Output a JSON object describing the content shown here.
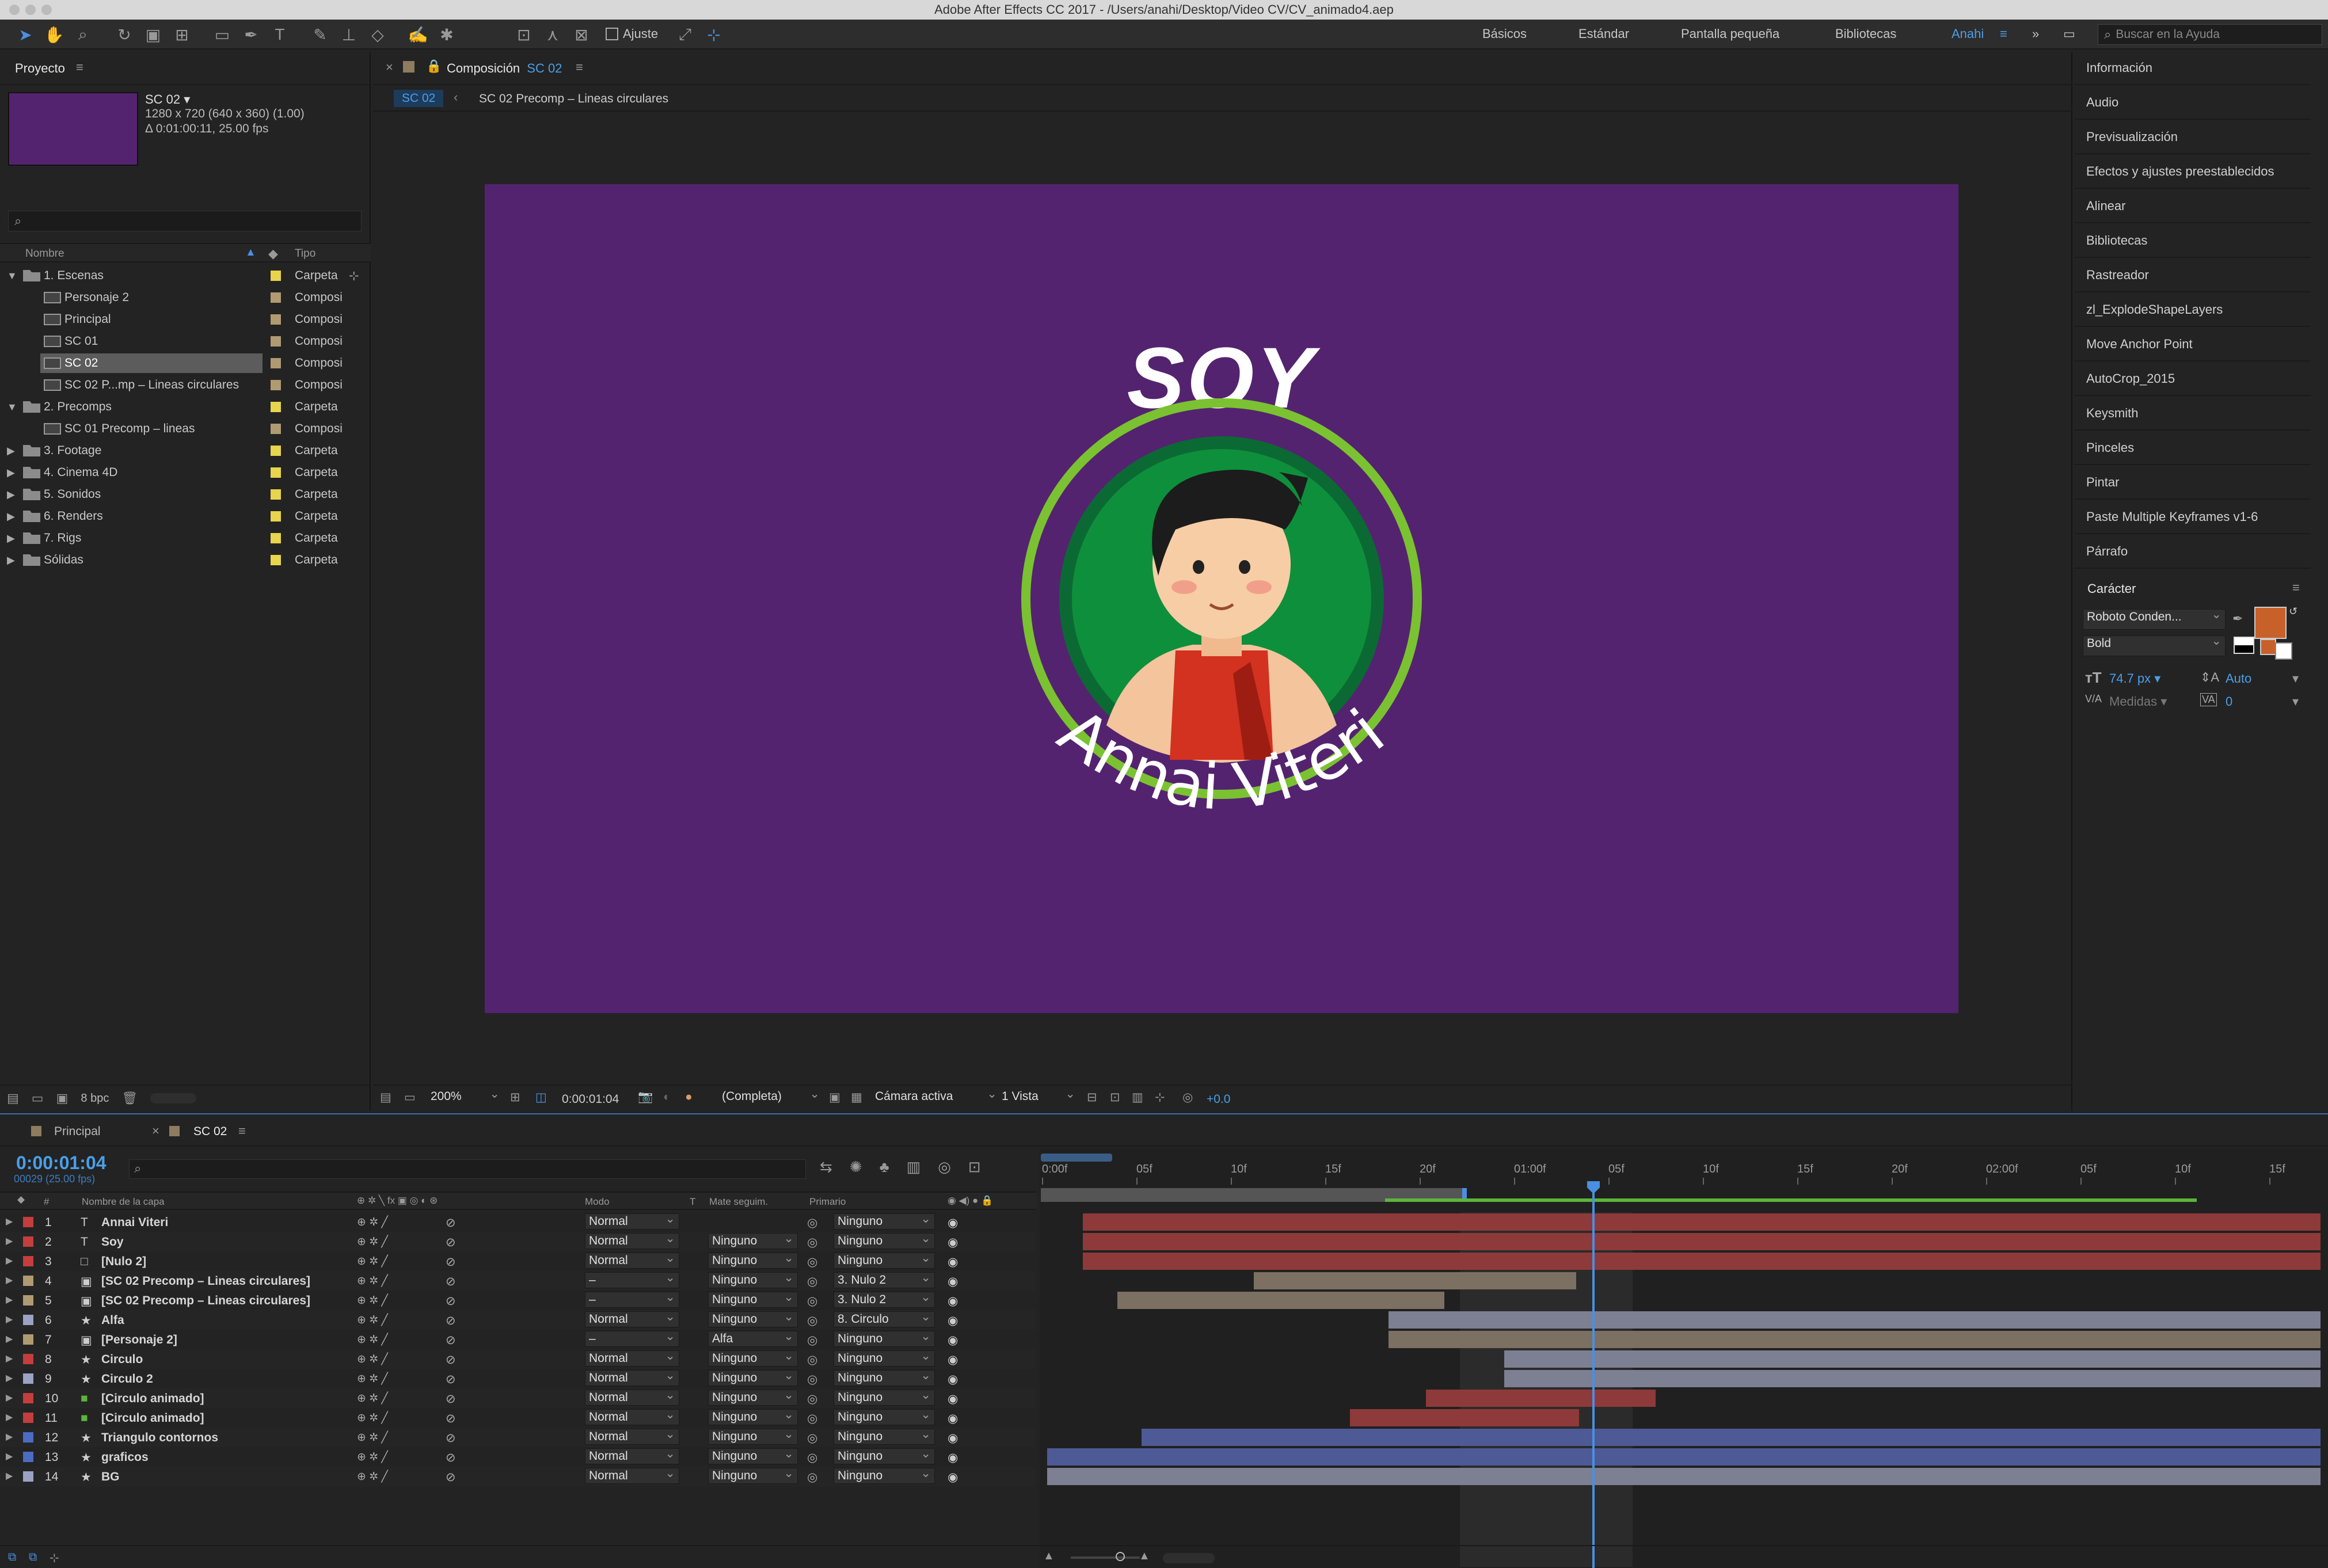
{
  "app": {
    "title": "Adobe After Effects CC 2017 - /Users/anahi/Desktop/Video CV/CV_animado4.aep"
  },
  "toolbar": {
    "snap_label": "Ajuste",
    "workspaces": [
      "Básicos",
      "Estándar",
      "Pantalla pequeña",
      "Bibliotecas",
      "Anahi"
    ],
    "active_workspace": "Anahi",
    "search_placeholder": "Buscar en la Ayuda"
  },
  "project": {
    "title": "Proyecto",
    "selected_name": "SC 02 ▾",
    "selected_info1": "1280 x 720  (640 x 360) (1.00)",
    "selected_info2": "Δ 0:01:00:11, 25.00 fps",
    "col_name": "Nombre",
    "col_type": "Tipo",
    "items": [
      {
        "name": "1. Escenas",
        "type": "Carpeta",
        "kind": "folder",
        "indent": 0,
        "open": true
      },
      {
        "name": "Personaje 2",
        "type": "Composi",
        "kind": "comp",
        "indent": 1
      },
      {
        "name": "Principal",
        "type": "Composi",
        "kind": "comp",
        "indent": 1
      },
      {
        "name": "SC 01",
        "type": "Composi",
        "kind": "comp",
        "indent": 1
      },
      {
        "name": "SC 02",
        "type": "Composi",
        "kind": "comp",
        "indent": 1,
        "selected": true
      },
      {
        "name": "SC 02 P...mp – Lineas circulares",
        "type": "Composi",
        "kind": "comp",
        "indent": 1
      },
      {
        "name": "2. Precomps",
        "type": "Carpeta",
        "kind": "folder",
        "indent": 0,
        "open": true
      },
      {
        "name": "SC 01 Precomp – lineas",
        "type": "Composi",
        "kind": "comp",
        "indent": 1
      },
      {
        "name": "3. Footage",
        "type": "Carpeta",
        "kind": "folder",
        "indent": 0
      },
      {
        "name": "4. Cinema 4D",
        "type": "Carpeta",
        "kind": "folder",
        "indent": 0
      },
      {
        "name": "5. Sonidos",
        "type": "Carpeta",
        "kind": "folder",
        "indent": 0
      },
      {
        "name": "6. Renders",
        "type": "Carpeta",
        "kind": "folder",
        "indent": 0
      },
      {
        "name": "7. Rigs",
        "type": "Carpeta",
        "kind": "folder",
        "indent": 0
      },
      {
        "name": "Sólidas",
        "type": "Carpeta",
        "kind": "folder",
        "indent": 0
      }
    ],
    "bpc": "8 bpc"
  },
  "composition": {
    "panel_label": "Composición",
    "panel_comp": "SC 02",
    "crumb_active": "SC 02",
    "crumb_child": "SC 02 Precomp – Lineas circulares",
    "canvas_title": "SOY",
    "canvas_name": "Annai Viteri",
    "zoom": "200%",
    "timecode": "0:00:01:04",
    "resolution": "(Completa)",
    "camera": "Cámara activa",
    "views": "1 Vista",
    "exposure": "+0.0"
  },
  "right_panel": {
    "items": [
      "Información",
      "Audio",
      "Previsualización",
      "Efectos y ajustes preestablecidos",
      "Alinear",
      "Bibliotecas",
      "Rastreador",
      "zl_ExplodeShapeLayers",
      "Move Anchor Point",
      "AutoCrop_2015",
      "Keysmith",
      "Pinceles",
      "Pintar",
      "Paste Multiple Keyframes v1-6",
      "Párrafo"
    ],
    "character": {
      "title": "Carácter",
      "font": "Roboto Conden...",
      "style": "Bold",
      "size": "74.7 px ▾",
      "leading": "Auto",
      "kerning": "Medidas ▾",
      "tracking": "0",
      "fill_color": "#c8602a"
    }
  },
  "timeline": {
    "tabs": [
      "Principal",
      "SC 02"
    ],
    "timecode": "0:00:01:04",
    "frame_info": "00029 (25.00 fps)",
    "col_num": "#",
    "col_name": "Nombre de la capa",
    "col_mode": "Modo",
    "col_t": "T",
    "col_matte": "Mate seguim.",
    "col_parent": "Primario",
    "ruler": [
      "0:00f",
      "05f",
      "10f",
      "15f",
      "20f",
      "01:00f",
      "05f",
      "10f",
      "15f",
      "20f",
      "02:00f",
      "05f",
      "10f",
      "15f"
    ],
    "layers": [
      {
        "num": "1",
        "name": "Annai Viteri",
        "icon": "T",
        "label": "#c43e3e",
        "mode": "Normal",
        "matte": "",
        "parent": "Ninguno",
        "bar_start": 29,
        "bar_end": 855,
        "bar_color": "#8e3a3a"
      },
      {
        "num": "2",
        "name": "Soy",
        "icon": "T",
        "label": "#c43e3e",
        "mode": "Normal",
        "matte": "Ninguno",
        "parent": "Ninguno",
        "bar_start": 29,
        "bar_end": 855,
        "bar_color": "#8e3a3a"
      },
      {
        "num": "3",
        "name": "[Nulo 2]",
        "icon": "null",
        "label": "#c43e3e",
        "mode": "Normal",
        "matte": "Ninguno",
        "parent": "Ninguno",
        "bar_start": 29,
        "bar_end": 855,
        "bar_color": "#8e3a3a"
      },
      {
        "num": "4",
        "name": "[SC 02 Precomp – Lineas circulares]",
        "icon": "comp",
        "label": "#b09a72",
        "mode": "–",
        "matte": "Ninguno",
        "parent": "3. Nulo 2",
        "bar_start": 143,
        "bar_end": 358,
        "bar_color": "#7c7062"
      },
      {
        "num": "5",
        "name": "[SC 02 Precomp – Lineas circulares]",
        "icon": "comp",
        "label": "#b09a72",
        "mode": "–",
        "matte": "Ninguno",
        "parent": "3. Nulo 2",
        "bar_start": 52,
        "bar_end": 270,
        "bar_color": "#7c7062"
      },
      {
        "num": "6",
        "name": "Alfa",
        "icon": "shape",
        "label": "#9aa3c4",
        "mode": "Normal",
        "matte": "Ninguno",
        "parent": "8. Circulo",
        "bar_start": 233,
        "bar_end": 855,
        "bar_color": "#7d7f93"
      },
      {
        "num": "7",
        "name": "[Personaje 2]",
        "icon": "comp",
        "label": "#b09a72",
        "mode": "–",
        "matte": "Alfa",
        "parent": "Ninguno",
        "bar_start": 233,
        "bar_end": 855,
        "bar_color": "#7c7062"
      },
      {
        "num": "8",
        "name": "Circulo",
        "icon": "shape",
        "label": "#c43e3e",
        "mode": "Normal",
        "matte": "Ninguno",
        "parent": "Ninguno",
        "bar_start": 310,
        "bar_end": 855,
        "bar_color": "#7d7f93"
      },
      {
        "num": "9",
        "name": "Circulo 2",
        "icon": "shape",
        "label": "#9aa3c4",
        "mode": "Normal",
        "matte": "Ninguno",
        "parent": "Ninguno",
        "bar_start": 310,
        "bar_end": 855,
        "bar_color": "#7d7f93"
      },
      {
        "num": "10",
        "name": "[Circulo animado]",
        "icon": "solid-green",
        "label": "#c43e3e",
        "mode": "Normal",
        "matte": "Ninguno",
        "parent": "Ninguno",
        "bar_start": 258,
        "bar_end": 411,
        "bar_color": "#8e3a3a"
      },
      {
        "num": "11",
        "name": "[Circulo animado]",
        "icon": "solid-green",
        "label": "#c43e3e",
        "mode": "Normal",
        "matte": "Ninguno",
        "parent": "Ninguno",
        "bar_start": 207,
        "bar_end": 360,
        "bar_color": "#8e3a3a"
      },
      {
        "num": "12",
        "name": "Triangulo contornos",
        "icon": "star",
        "label": "#4c6bc4",
        "mode": "Normal",
        "matte": "Ninguno",
        "parent": "Ninguno",
        "bar_start": 68,
        "bar_end": 855,
        "bar_color": "#4e5a95"
      },
      {
        "num": "13",
        "name": "graficos",
        "icon": "star",
        "label": "#4c6bc4",
        "mode": "Normal",
        "matte": "Ninguno",
        "parent": "Ninguno",
        "bar_start": 5,
        "bar_end": 855,
        "bar_color": "#4e5a95"
      },
      {
        "num": "14",
        "name": "BG",
        "icon": "shape",
        "label": "#9aa3c4",
        "mode": "Normal",
        "matte": "Ninguno",
        "parent": "Ninguno",
        "bar_start": 5,
        "bar_end": 855,
        "bar_color": "#7d7f93"
      }
    ]
  }
}
